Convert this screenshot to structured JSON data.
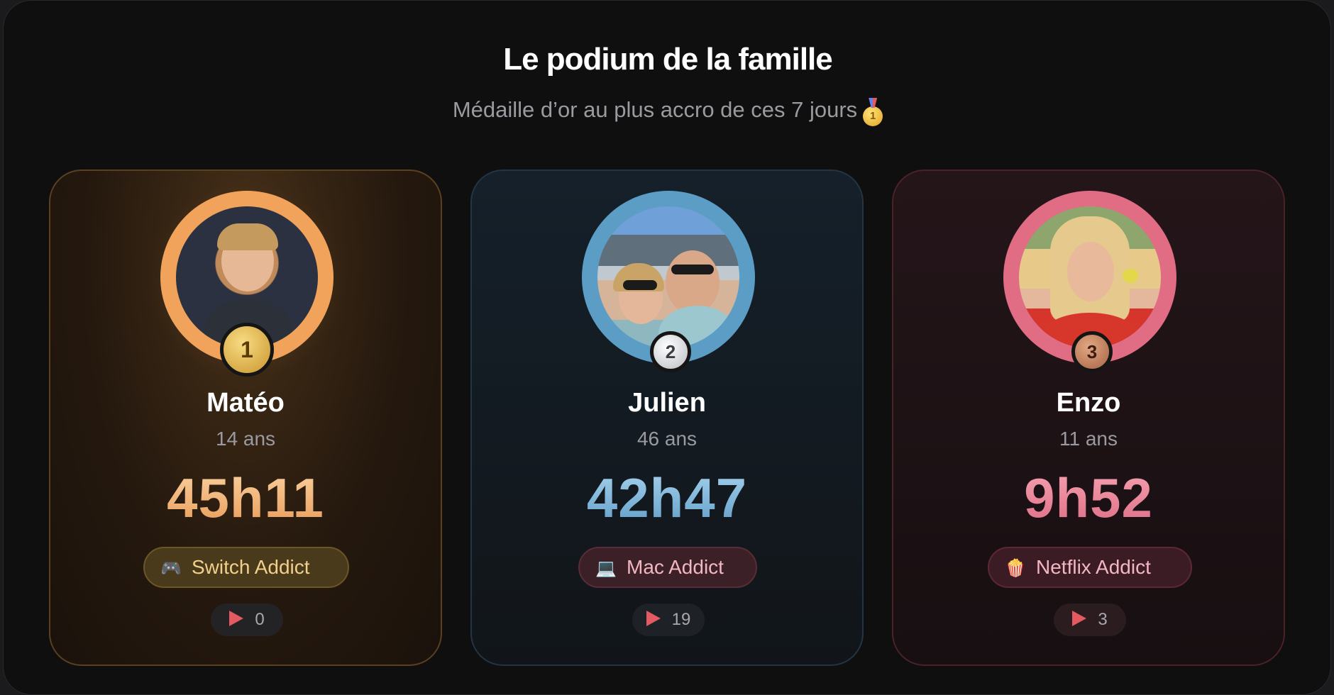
{
  "header": {
    "title": "Le podium de la famille",
    "subtitle": "Médaille d’or au plus accro de ces 7 jours",
    "subtitle_emoji": "gold-medal-icon"
  },
  "podium": [
    {
      "rank": "1",
      "name": "Matéo",
      "age": "14 ans",
      "time": "45h11",
      "badge_icon": "🎮",
      "badge_label": "Switch Addict",
      "plays": "0",
      "ring_color": "#f2a35b"
    },
    {
      "rank": "2",
      "name": "Julien",
      "age": "46 ans",
      "time": "42h47",
      "badge_icon": "💻",
      "badge_label": "Mac Addict",
      "plays": "19",
      "ring_color": "#5b9dc5"
    },
    {
      "rank": "3",
      "name": "Enzo",
      "age": "11 ans",
      "time": "9h52",
      "badge_icon": "🍿",
      "badge_label": "Netflix Addict",
      "plays": "3",
      "ring_color": "#e06d84"
    }
  ]
}
